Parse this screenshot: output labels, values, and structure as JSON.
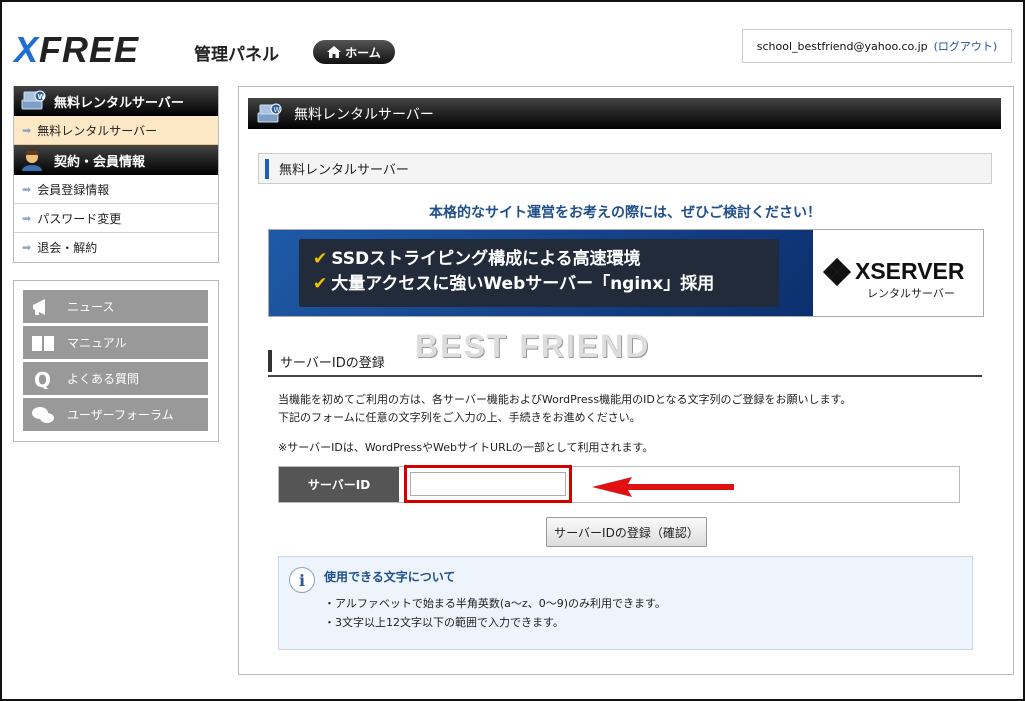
{
  "header": {
    "logo": "XFREE",
    "panel_title": "管理パネル",
    "home_label": "ホーム",
    "user_email": "school_bestfriend@yahoo.co.jp",
    "logout_label": "(ログアウト)"
  },
  "sidebar": {
    "section1_title": "無料レンタルサーバー",
    "section1_items": [
      {
        "label": "無料レンタルサーバー"
      }
    ],
    "section2_title": "契約・会員情報",
    "section2_items": [
      {
        "label": "会員登録情報"
      },
      {
        "label": "パスワード変更"
      },
      {
        "label": "退会・解約"
      }
    ],
    "nav_buttons": [
      {
        "label": "ニュース",
        "icon": "megaphone-icon"
      },
      {
        "label": "マニュアル",
        "icon": "book-icon"
      },
      {
        "label": "よくある質問",
        "icon": "q-icon"
      },
      {
        "label": "ユーザーフォーラム",
        "icon": "chat-icon"
      }
    ]
  },
  "main": {
    "title": "無料レンタルサーバー",
    "subtitle": "無料レンタルサーバー",
    "tagline": "本格的なサイト運営をお考えの際には、ぜひご検討ください！",
    "banner": {
      "line1": "SSDストライピング構成による高速環境",
      "line2": "大量アクセスに強いWebサーバー「nginx」採用",
      "brand": "XSERVER",
      "brand_sub": "レンタルサーバー"
    },
    "watermark": "BEST FRIEND",
    "section_title": "サーバーIDの登録",
    "desc_line1": "当機能を初めてご利用の方は、各サーバー機能およびWordPress機能用のIDとなる文字列のご登録をお願いします。",
    "desc_line2": "下記のフォームに任意の文字列をご入力の上、手続きをお進めください。",
    "note": "※サーバーIDは、WordPressやWebサイトURLの一部として利用されます。",
    "id_label": "サーバーID",
    "id_value": "",
    "confirm_label": "サーバーIDの登録（確認）",
    "info": {
      "title": "使用できる文字について",
      "line1": "・アルファベットで始まる半角英数(a～z、0～9)のみ利用できます。",
      "line2": "・3文字以上12文字以下の範囲で入力できます。"
    }
  },
  "colors": {
    "accent_blue": "#1f5fb8",
    "highlight_red": "#d40000",
    "active_item_bg": "#fde8c6"
  }
}
